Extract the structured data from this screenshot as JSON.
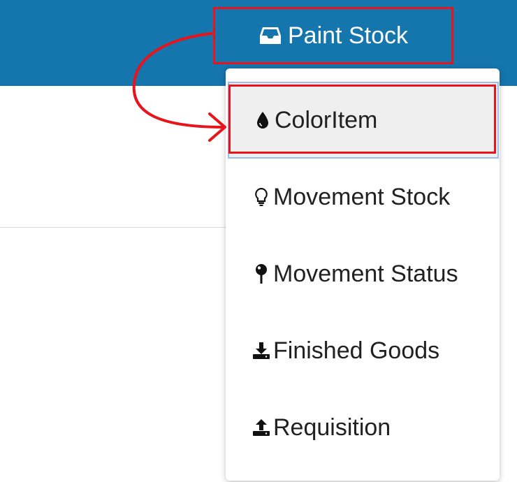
{
  "header": {
    "nav_item": {
      "label": "Paint Stock",
      "icon": "inbox-icon"
    }
  },
  "dropdown": {
    "items": [
      {
        "label": "ColorItem",
        "icon": "tint-icon",
        "active": true
      },
      {
        "label": "Movement Stock",
        "icon": "lightbulb-icon",
        "active": false
      },
      {
        "label": "Movement Status",
        "icon": "map-pin-icon",
        "active": false
      },
      {
        "label": "Finished Goods",
        "icon": "download-icon",
        "active": false
      },
      {
        "label": "Requisition",
        "icon": "upload-icon",
        "active": false
      }
    ]
  },
  "colors": {
    "header_bg": "#1575ad",
    "highlight_red": "#e8141b",
    "active_item_bg": "#efefef",
    "active_item_border": "#9bbdf0"
  }
}
